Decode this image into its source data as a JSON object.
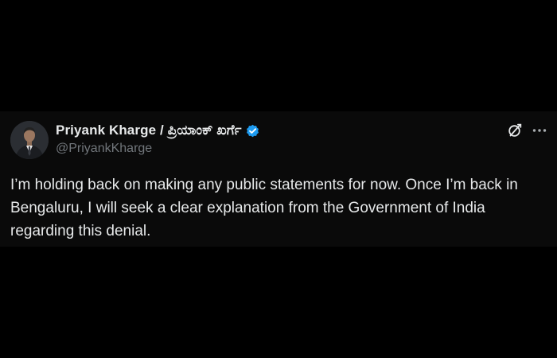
{
  "tweet": {
    "author": {
      "display_name": "Priyank Kharge / ಪ್ರಿಯಾಂಕ್ ಖರ್ಗೆ",
      "handle": "@PriyankKharge",
      "verified": true,
      "avatar_icon": "person-avatar"
    },
    "text": "I’m holding back on making any public statements for now. Once I’m back in Bengaluru, I will seek a clear explanation from the Government of India regarding this denial.",
    "actions": {
      "grok_icon": "grok-icon",
      "more_icon": "more-options-icon"
    }
  },
  "colors": {
    "page_background": "#000000",
    "card_background": "#0a0a0a",
    "text_primary": "#e7e9ea",
    "text_secondary": "#71767b",
    "verified_blue": "#1d9bf0"
  }
}
